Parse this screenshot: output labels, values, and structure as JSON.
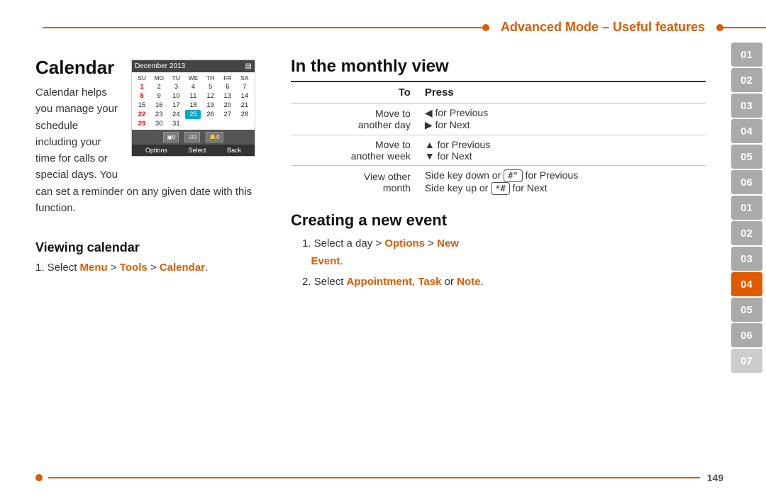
{
  "header": {
    "title": "Advanced Mode – Useful features"
  },
  "sidebar": {
    "items": [
      {
        "label": "01",
        "state": "gray"
      },
      {
        "label": "02",
        "state": "gray"
      },
      {
        "label": "03",
        "state": "gray"
      },
      {
        "label": "04",
        "state": "gray"
      },
      {
        "label": "05",
        "state": "gray"
      },
      {
        "label": "06",
        "state": "gray"
      },
      {
        "label": "01",
        "state": "gray"
      },
      {
        "label": "02",
        "state": "gray"
      },
      {
        "label": "03",
        "state": "gray"
      },
      {
        "label": "04",
        "state": "active"
      },
      {
        "label": "05",
        "state": "gray"
      },
      {
        "label": "06",
        "state": "gray"
      },
      {
        "label": "07",
        "state": "light-gray"
      }
    ]
  },
  "left": {
    "title": "Calendar",
    "body": "Calendar helps you manage your schedule including your time for calls or special days. You can set a reminder on any given date with this function.",
    "calendar_month": "December 2013",
    "calendar_days": [
      "SU",
      "MO",
      "TU",
      "WE",
      "TH",
      "FR",
      "SA"
    ],
    "calendar_rows": [
      [
        "1",
        "2",
        "3",
        "4",
        "5",
        "6",
        "7"
      ],
      [
        "8",
        "9",
        "10",
        "11",
        "12",
        "13",
        "14"
      ],
      [
        "15",
        "16",
        "17",
        "18",
        "19",
        "20",
        "21"
      ],
      [
        "22",
        "23",
        "24",
        "25",
        "26",
        "27",
        "28"
      ],
      [
        "29",
        "30",
        "31",
        "",
        "",
        "",
        ""
      ]
    ],
    "highlight_cell": "25",
    "red_cells": [
      "1",
      "8",
      "22",
      "29"
    ],
    "footer_labels": [
      "Options",
      "Select",
      "Back"
    ],
    "subsection_title": "Viewing calendar",
    "steps": [
      {
        "num": "1.",
        "text_before": "Select ",
        "menu": "Menu",
        "sep1": " > ",
        "tools": "Tools",
        "sep2": " > ",
        "calendar": "Calendar",
        "text_after": "."
      }
    ]
  },
  "right": {
    "monthly_title": "In the monthly view",
    "table_headers": {
      "to": "To",
      "press": "Press"
    },
    "table_rows": [
      {
        "to": "Move to another day",
        "press_left": "◀ for Previous",
        "press_right": "▶ for Next",
        "divider": false
      },
      {
        "to": "Move to another week",
        "press_left": "▲ for Previous",
        "press_right": "▼ for Next",
        "divider": true
      },
      {
        "to": "View other month",
        "press_lines": [
          "Side key down or  #  for Previous",
          "Side key up or  *#  for Next"
        ],
        "divider": true
      }
    ],
    "creating_title": "Creating a new event",
    "creating_steps": [
      {
        "num": "1.",
        "text_before": "Select a day > ",
        "options": "Options",
        "sep": " > ",
        "new": "New Event",
        "text_after": "."
      },
      {
        "num": "2.",
        "text_before": "Select ",
        "appointment": "Appointment",
        "sep1": ", ",
        "task": "Task",
        "sep2": " or ",
        "note": "Note",
        "text_after": "."
      }
    ]
  },
  "footer": {
    "page_number": "149"
  }
}
